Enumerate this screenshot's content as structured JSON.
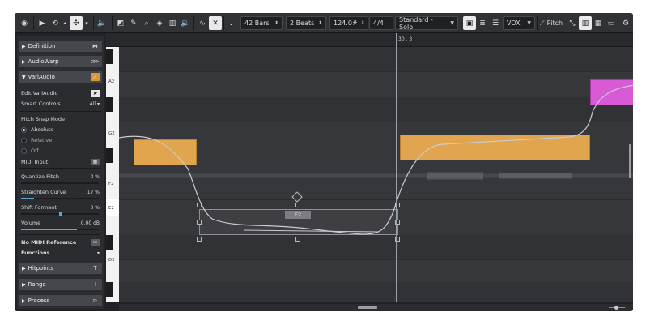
{
  "toolbar": {
    "bars": "42 Bars",
    "beats": "2 Beats",
    "tempo": "124.0#",
    "signature": "4/4",
    "preset": "Standard - Solo",
    "track": "VOX",
    "pitch_label": "Pitch"
  },
  "ruler": {
    "position": "30 . 3"
  },
  "inspector": {
    "definition": "Definition",
    "audiowarp": "AudioWarp",
    "variaudio": "VariAudio",
    "edit_variaudio": "Edit VariAudio",
    "smart_controls": "Smart Controls",
    "smart_controls_value": "All",
    "pitch_snap_mode": "Pitch Snap Mode",
    "snap_absolute": "Absolute",
    "snap_relative": "Relative",
    "snap_off": "Off",
    "midi_input": "MIDI Input",
    "quantize_pitch": "Quantize Pitch",
    "quantize_pitch_value": "0 %",
    "straighten_curve": "Straighten Curve",
    "straighten_curve_value": "17 %",
    "shift_formant": "Shift Formant",
    "shift_formant_value": "0 %",
    "volume": "Volume",
    "volume_value": "0.00 dB",
    "no_midi_reference": "No MIDI Reference",
    "functions": "Functions",
    "hitpoints": "Hitpoints",
    "range": "Range",
    "process": "Process"
  },
  "levels": {
    "quantize_pitch": 0,
    "straighten_curve": 0.17,
    "shift_formant": 0.5,
    "volume": 0.72
  },
  "keys": {
    "a2": "A2",
    "g2": "G2",
    "f2": "F2",
    "e2": "E2",
    "d2": "D2"
  },
  "note": {
    "selected_pitch": "E2"
  },
  "colors": {
    "note": "#e1a54f",
    "note_selected": "#d95ad6",
    "accent": "#5aa7d6"
  }
}
